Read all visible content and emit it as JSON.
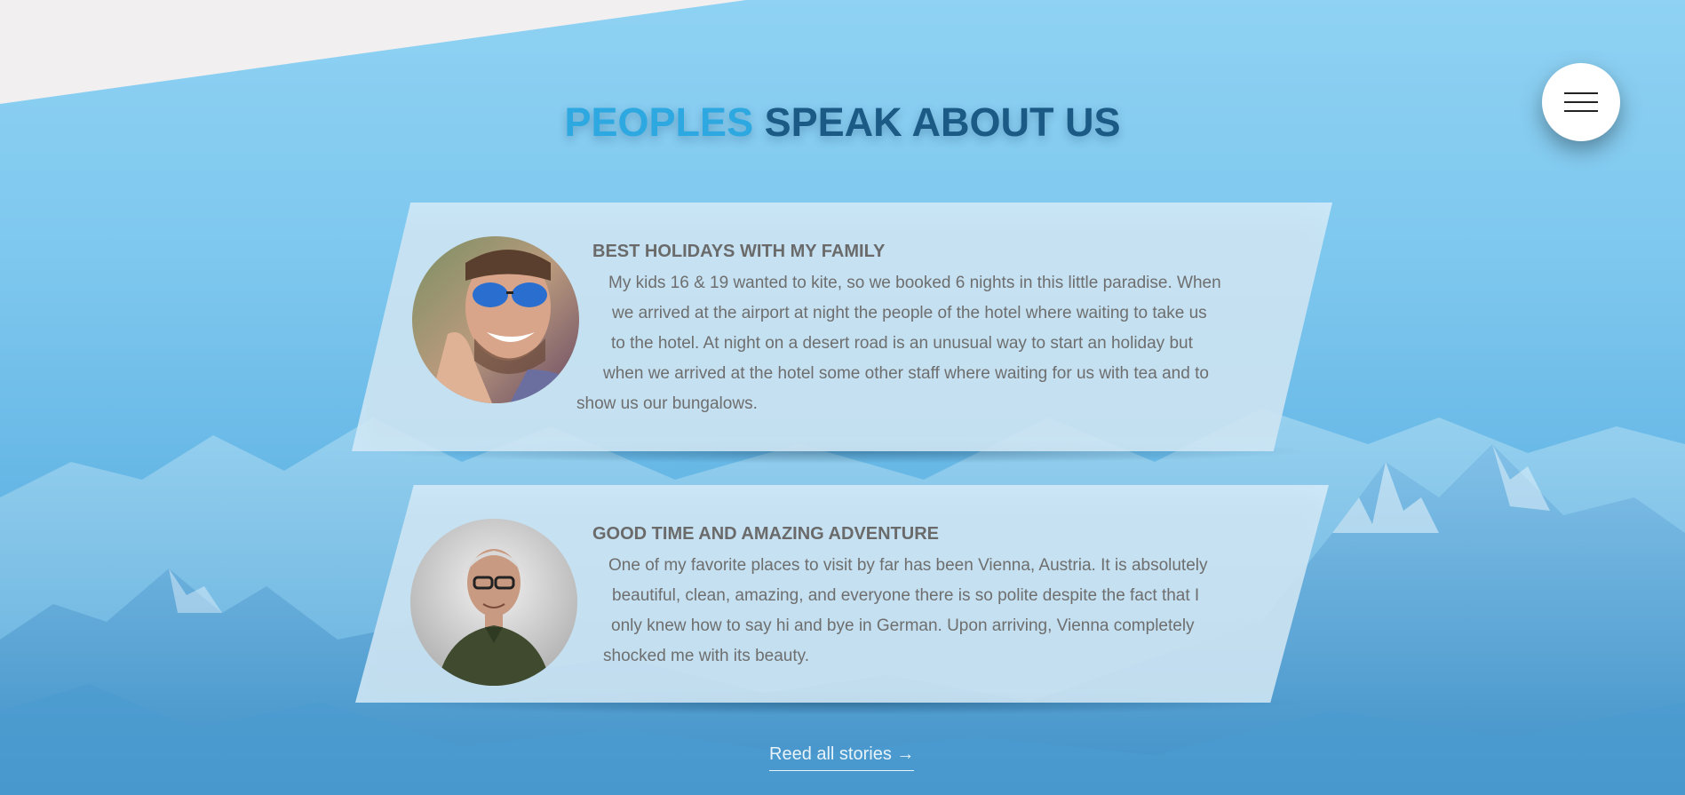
{
  "section": {
    "title_part1": "PEOPLES",
    "title_part2": "SPEAK ABOUT US"
  },
  "menu": {
    "icon": "hamburger-menu-icon"
  },
  "testimonials": [
    {
      "title": "BEST HOLIDAYS WITH MY FAMILY",
      "avatar": "man-with-sunglasses-photo",
      "lines": [
        "My kids 16 & 19 wanted to kite, so we booked 6 nights in this little paradise. When",
        "we arrived at the airport at night the people of the hotel where waiting to take us",
        "to the hotel. At night on a desert road is an unusual way to start an holiday but",
        "when we arrived at the hotel some other staff where waiting for us with tea and to",
        "show us our bungalows."
      ]
    },
    {
      "title": "GOOD TIME AND AMAZING ADVENTURE",
      "avatar": "older-man-with-glasses-photo",
      "lines": [
        "One of my favorite places to visit by far has been Vienna, Austria. It is absolutely",
        "beautiful, clean, amazing, and everyone there is so polite despite the fact that I",
        "only knew how to say hi and bye in German. Upon arriving, Vienna completely",
        "shocked me with its beauty."
      ]
    }
  ],
  "link": {
    "label": "Reed all stories →"
  },
  "colors": {
    "title_light": "#2ea8e0",
    "title_dark": "#1a5a85",
    "card_bg": "#d6eefc",
    "text": "#6e6e6e"
  }
}
